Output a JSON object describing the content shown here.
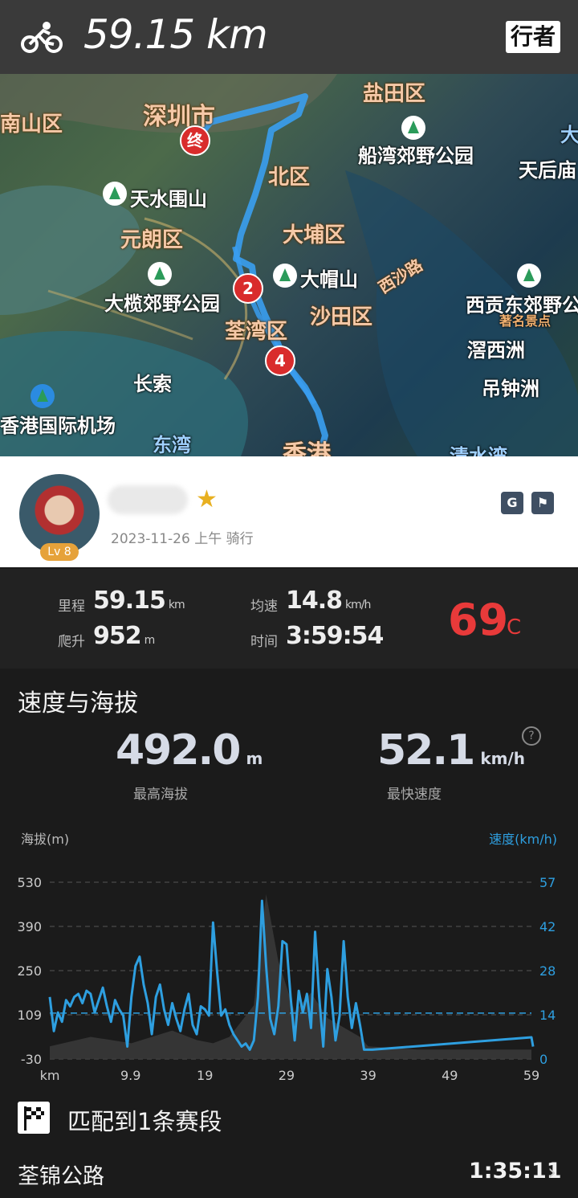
{
  "header": {
    "distance": "59.15 km",
    "brand": "行者",
    "icon": "bicycle-icon"
  },
  "map": {
    "labels": [
      {
        "text": "深圳市",
        "kind": "dist"
      },
      {
        "text": "南山区",
        "kind": "dist"
      },
      {
        "text": "盐田区",
        "kind": "dist"
      },
      {
        "text": "船湾郊野公园",
        "kind": "park"
      },
      {
        "text": "天后庙",
        "kind": "plain"
      },
      {
        "text": "天水围山",
        "kind": "park"
      },
      {
        "text": "北区",
        "kind": "dist"
      },
      {
        "text": "元朗区",
        "kind": "dist"
      },
      {
        "text": "大埔区",
        "kind": "dist"
      },
      {
        "text": "大帽山",
        "kind": "park"
      },
      {
        "text": "大榄郊野公园",
        "kind": "park"
      },
      {
        "text": "沙田区",
        "kind": "dist"
      },
      {
        "text": "西沙路",
        "kind": "road"
      },
      {
        "text": "西贡东郊野公",
        "kind": "park"
      },
      {
        "text": "著名景点",
        "kind": "tag"
      },
      {
        "text": "荃湾区",
        "kind": "dist"
      },
      {
        "text": "滘西洲",
        "kind": "plain"
      },
      {
        "text": "长索",
        "kind": "plain"
      },
      {
        "text": "吊钟洲",
        "kind": "plain"
      },
      {
        "text": "香港国际机场",
        "kind": "plain"
      },
      {
        "text": "东湾",
        "kind": "plain"
      },
      {
        "text": "香港",
        "kind": "dist"
      },
      {
        "text": "清水湾",
        "kind": "plain"
      },
      {
        "text": "大",
        "kind": "plain"
      }
    ],
    "markers": {
      "end": "终",
      "m2": "2",
      "m4": "4"
    }
  },
  "user": {
    "level": "Lv 8",
    "date": "2023-11-26 上午 骑行",
    "badge_a": "G",
    "badge_b": "⚑"
  },
  "stats": {
    "distance_label": "里程",
    "distance_value": "59.15",
    "distance_unit": "km",
    "climb_label": "爬升",
    "climb_value": "952",
    "climb_unit": "m",
    "avg_label": "均速",
    "avg_value": "14.8",
    "avg_unit": "km/h",
    "time_label": "时间",
    "time_value": "3:59:54",
    "temp_value": "69",
    "temp_unit": "°C"
  },
  "speed_altitude": {
    "title": "速度与海拔",
    "max_alt_value": "492.0",
    "max_alt_unit": "m",
    "max_alt_label": "最高海拔",
    "max_speed_value": "52.1",
    "max_speed_unit": "km/h",
    "max_speed_label": "最快速度",
    "help": "?"
  },
  "chart_data": {
    "type": "area",
    "left_axis_label": "海拔(m)",
    "right_axis_label": "速度(km/h)",
    "left_ticks": [
      "530",
      "390",
      "250",
      "109",
      "-30"
    ],
    "right_ticks": [
      "57",
      "42",
      "28",
      "14",
      "0"
    ],
    "x_ticks": [
      "km",
      "9.9",
      "19",
      "29",
      "39",
      "49",
      "59"
    ],
    "left_range": [
      -30,
      530
    ],
    "right_range": [
      0,
      57
    ],
    "x_range": [
      0,
      59
    ],
    "avg_speed": 14.8,
    "colors": {
      "speed": "#2e9fe0",
      "altitude": "#3a3a3a",
      "avg_line": "#2e9fe0"
    },
    "series": [
      {
        "name": "速度",
        "axis": "right",
        "x": [
          0,
          0.5,
          1,
          1.5,
          2,
          2.5,
          3,
          3.5,
          4,
          4.5,
          5,
          5.5,
          6,
          6.5,
          7,
          7.5,
          8,
          8.5,
          9,
          9.5,
          10,
          10.5,
          11,
          11.5,
          12,
          12.5,
          13,
          13.5,
          14,
          14.5,
          15,
          15.5,
          16,
          16.5,
          17,
          17.5,
          18,
          18.5,
          19,
          19.5,
          20,
          20.5,
          21,
          21.5,
          22,
          22.5,
          23,
          23.5,
          24,
          24.5,
          25,
          25.5,
          26,
          26.5,
          27,
          27.5,
          28,
          28.5,
          29,
          29.5,
          30,
          30.5,
          31,
          31.5,
          32,
          32.5,
          33,
          33.5,
          34,
          34.5,
          35,
          35.5,
          36,
          36.5,
          37,
          37.5,
          38,
          38.5,
          39,
          39.5,
          59,
          59.2
        ],
        "values": [
          20,
          9,
          15,
          12,
          19,
          17,
          20,
          21,
          18,
          22,
          21,
          15,
          19,
          23,
          17,
          12,
          19,
          16,
          14,
          4,
          20,
          30,
          33,
          24,
          18,
          8,
          20,
          24,
          16,
          11,
          18,
          13,
          9,
          16,
          21,
          11,
          8,
          17,
          16,
          14,
          44,
          28,
          14,
          16,
          11,
          8,
          6,
          4,
          5,
          3,
          6,
          20,
          51,
          30,
          13,
          8,
          17,
          38,
          37,
          20,
          6,
          22,
          15,
          21,
          10,
          41,
          20,
          4,
          29,
          20,
          6,
          14,
          38,
          20,
          10,
          18,
          11,
          3,
          3,
          3,
          7,
          4
        ]
      },
      {
        "name": "海拔",
        "axis": "left",
        "x": [
          0,
          5,
          10,
          15,
          18,
          20,
          22,
          25,
          26.5,
          28,
          30,
          32,
          34,
          36,
          38,
          39,
          45,
          59
        ],
        "values": [
          10,
          40,
          20,
          60,
          30,
          20,
          40,
          140,
          492,
          280,
          120,
          180,
          100,
          70,
          40,
          10,
          0,
          0
        ]
      }
    ]
  },
  "segments": {
    "title": "匹配到1条赛段",
    "items": [
      {
        "name": "荃锦公路",
        "time": "1:35:11"
      }
    ]
  }
}
